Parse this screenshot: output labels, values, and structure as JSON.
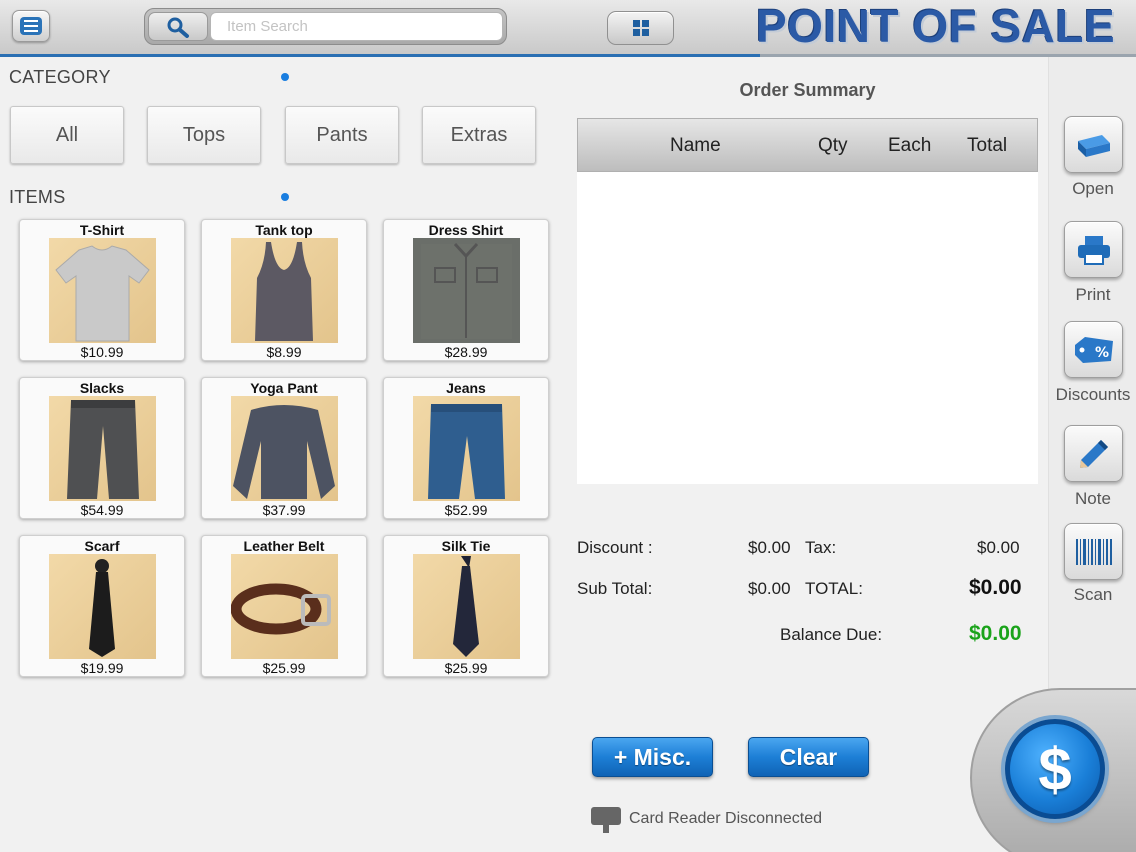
{
  "header": {
    "title": "POINT OF SALE",
    "search_placeholder": "Item Search"
  },
  "category": {
    "label": "CATEGORY",
    "buttons": [
      "All",
      "Tops",
      "Pants",
      "Extras"
    ]
  },
  "items": {
    "label": "ITEMS",
    "list": [
      {
        "name": "T-Shirt",
        "price": "$10.99",
        "icon": "tshirt"
      },
      {
        "name": "Tank top",
        "price": "$8.99",
        "icon": "tank-top"
      },
      {
        "name": "Dress Shirt",
        "price": "$28.99",
        "icon": "dress-shirt"
      },
      {
        "name": "Slacks",
        "price": "$54.99",
        "icon": "slacks"
      },
      {
        "name": "Yoga Pant",
        "price": "$37.99",
        "icon": "yoga-pant"
      },
      {
        "name": "Jeans",
        "price": "$52.99",
        "icon": "jeans"
      },
      {
        "name": "Scarf",
        "price": "$19.99",
        "icon": "scarf"
      },
      {
        "name": "Leather Belt",
        "price": "$25.99",
        "icon": "leather-belt"
      },
      {
        "name": "Silk Tie",
        "price": "$25.99",
        "icon": "silk-tie"
      }
    ]
  },
  "order": {
    "title": "Order Summary",
    "columns": [
      "Name",
      "Qty",
      "Each",
      "Total"
    ],
    "discount_label": "Discount :",
    "discount_value": "$0.00",
    "tax_label": "Tax:",
    "tax_value": "$0.00",
    "subtotal_label": "Sub Total:",
    "subtotal_value": "$0.00",
    "total_label": "TOTAL:",
    "total_value": "$0.00",
    "balance_label": "Balance Due:",
    "balance_value": "$0.00",
    "balance_color": "#1aa31a"
  },
  "sidebar": {
    "buttons": [
      {
        "label": "Open",
        "icon": "drawer-icon"
      },
      {
        "label": "Print",
        "icon": "printer-icon"
      },
      {
        "label": "Discounts",
        "icon": "discount-tag-icon"
      },
      {
        "label": "Note",
        "icon": "pencil-icon"
      },
      {
        "label": "Scan",
        "icon": "barcode-icon"
      }
    ]
  },
  "bottom": {
    "misc_label": "+ Misc.",
    "clear_label": "Clear",
    "card_status": "Card Reader Disconnected",
    "pay_symbol": "$"
  },
  "colors": {
    "accent": "#1a7fd8",
    "title": "#2b5aa6"
  }
}
